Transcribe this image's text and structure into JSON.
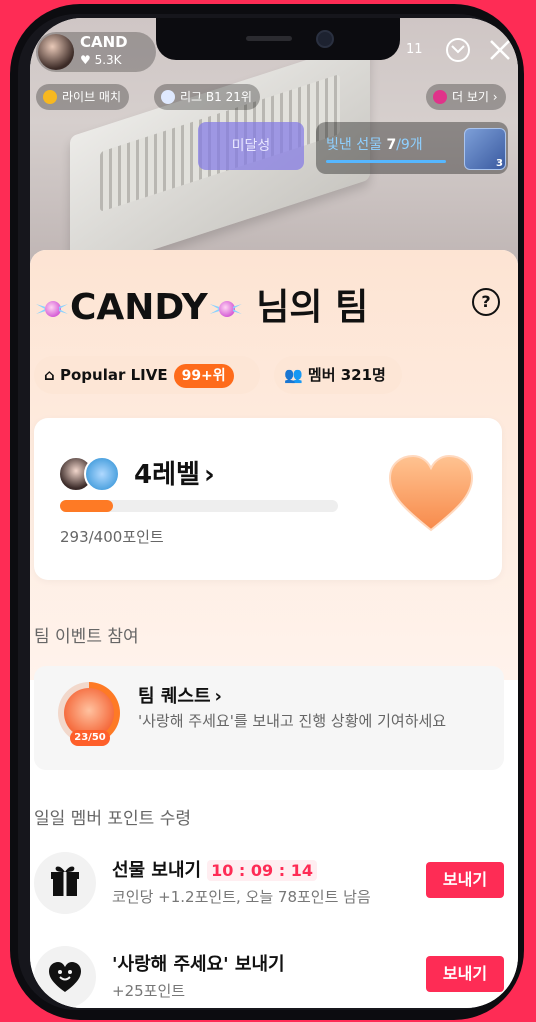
{
  "header": {
    "host_name": "CAND",
    "host_likes": "5.3K",
    "viewer_count": "11"
  },
  "chips": {
    "live_match": "라이브 매치",
    "league": "리그 B1 21위",
    "more": "더 보기 ›"
  },
  "stream": {
    "unmet_label": "미달성",
    "gift_progress_label": "빛낸 선물",
    "gift_progress_current": "7",
    "gift_progress_total": "/9개",
    "gift_box_count": "3"
  },
  "team": {
    "name": "CANDY",
    "suffix": "님의 팀",
    "popular_label": "Popular LIVE",
    "popular_rank": "99+위",
    "members_label": "멤버 321명",
    "level_label": "4레벨",
    "points_text": "293/400포인트",
    "points_current": 293,
    "points_max": 400
  },
  "events": {
    "section_title": "팀 이벤트 참여",
    "quest_title": "팀 퀘스트",
    "quest_desc": "'사랑해 주세요'를 보내고 진행 상황에 기여하세요",
    "quest_progress": "23/50"
  },
  "daily": {
    "section_title": "일일 멤버 포인트 수령",
    "items": [
      {
        "title": "선물 보내기",
        "countdown": "10 : 09 : 14",
        "subtitle": "코인당 +1.2포인트, 오늘 78포인트 남음",
        "button": "보내기",
        "icon": "gift-icon"
      },
      {
        "title": "'사랑해 주세요' 보내기",
        "subtitle": "+25포인트",
        "button": "보내기",
        "icon": "heart-face-icon"
      }
    ]
  },
  "colors": {
    "accent": "#fe2c55",
    "orange": "#fe7a25"
  }
}
